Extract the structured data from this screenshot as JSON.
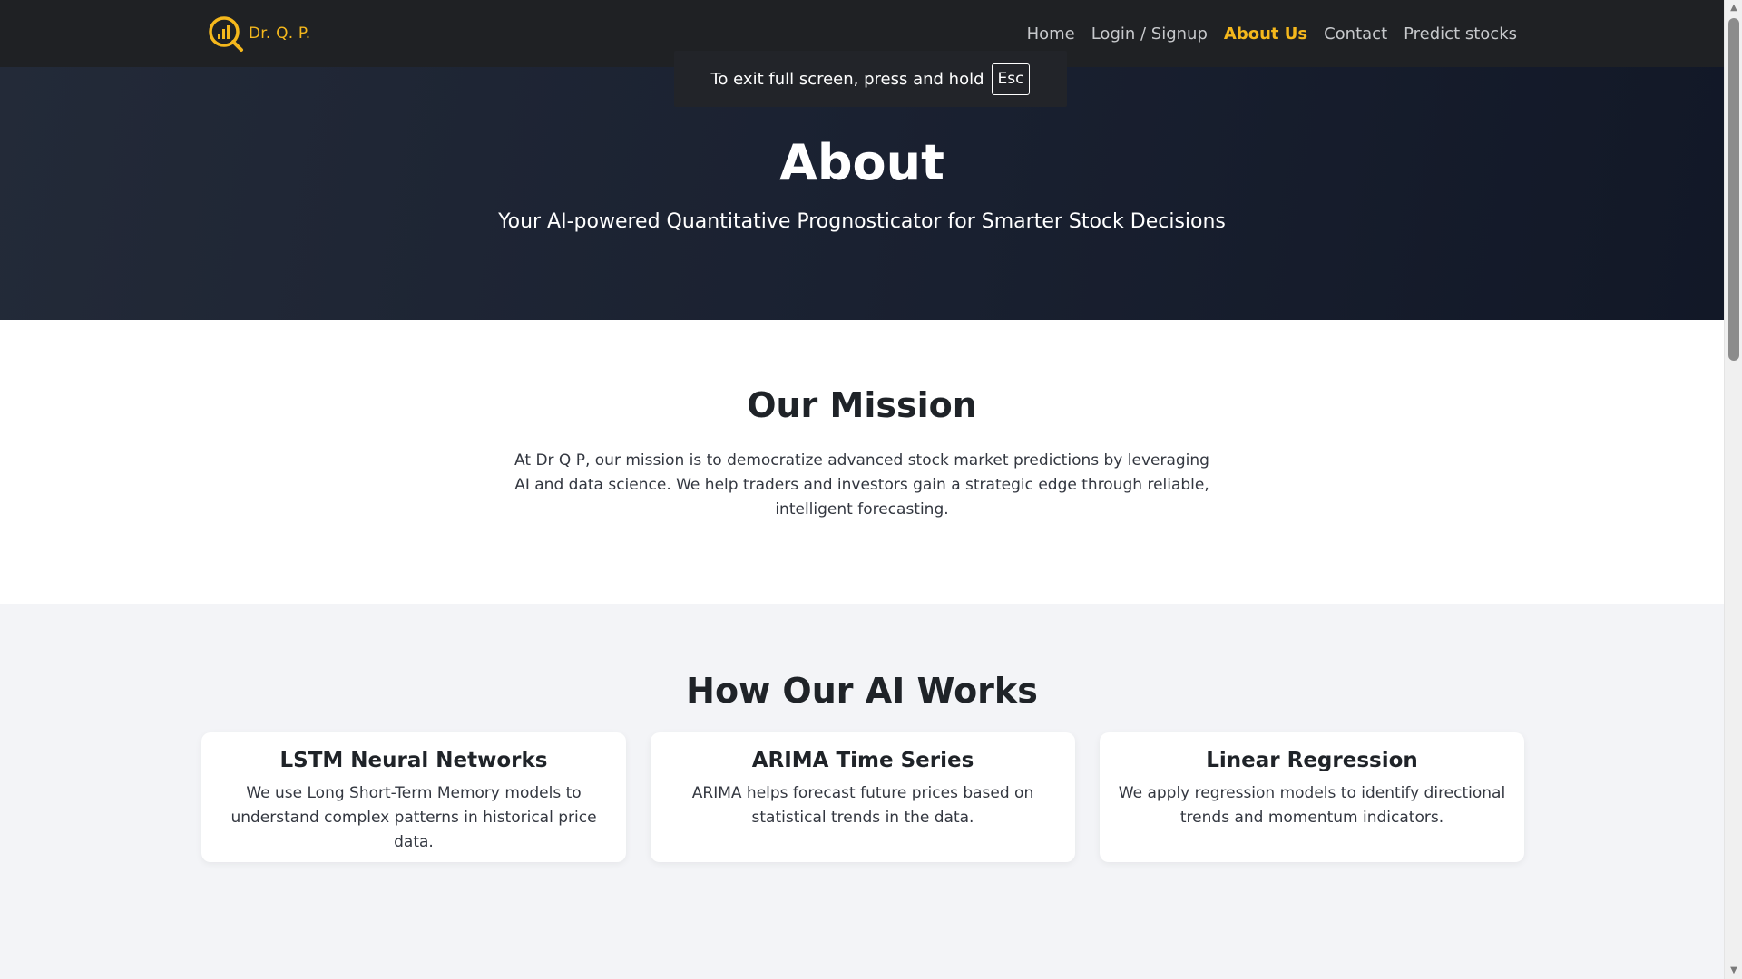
{
  "brand": {
    "name": "Dr. Q. P.",
    "logo_icon": "chart-magnifier-logo",
    "accent_color": "#f5b81c"
  },
  "nav": {
    "items": [
      {
        "label": "Home",
        "active": false
      },
      {
        "label": "Login / Signup",
        "active": false
      },
      {
        "label": "About Us",
        "active": true
      },
      {
        "label": "Contact",
        "active": false
      },
      {
        "label": "Predict stocks",
        "active": false
      }
    ]
  },
  "fullscreen_notice": {
    "text": "To exit full screen, press and hold",
    "key": "Esc"
  },
  "hero": {
    "title": "About",
    "subtitle": "Your AI-powered Quantitative Prognosticator for Smarter Stock Decisions"
  },
  "mission": {
    "title": "Our Mission",
    "text": "At Dr Q P, our mission is to democratize advanced stock market predictions by leveraging AI and data science. We help traders and investors gain a strategic edge through reliable, intelligent forecasting."
  },
  "how": {
    "title": "How Our AI Works",
    "cards": [
      {
        "title": "LSTM Neural Networks",
        "text": "We use Long Short-Term Memory models to understand complex patterns in historical price data."
      },
      {
        "title": "ARIMA Time Series",
        "text": "ARIMA helps forecast future prices based on statistical trends in the data."
      },
      {
        "title": "Linear Regression",
        "text": "We apply regression models to identify directional trends and momentum indicators."
      }
    ]
  },
  "scrollbar": {
    "up_icon": "scroll-up-arrow",
    "down_icon": "scroll-down-arrow"
  }
}
